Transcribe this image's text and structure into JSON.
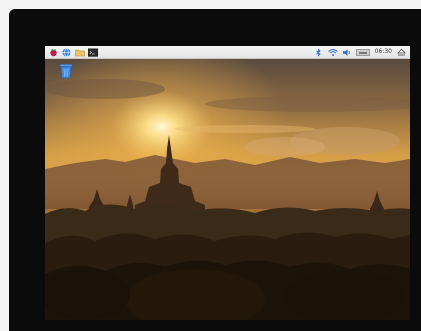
{
  "taskbar": {
    "launchers": [
      {
        "icon": "raspberry-menu-icon"
      },
      {
        "icon": "web-browser-icon"
      },
      {
        "icon": "file-manager-icon"
      },
      {
        "icon": "terminal-icon"
      }
    ],
    "tray": {
      "bluetooth_icon": "bluetooth-icon",
      "wifi_icon": "wifi-icon",
      "volume_icon": "volume-icon",
      "cpu_icon": "cpu-monitor-icon",
      "clock": "06:30",
      "eject_icon": "eject-icon"
    }
  },
  "desktop": {
    "icons": [
      {
        "icon": "wastebasket-icon"
      }
    ]
  },
  "colors": {
    "taskbar_bg": "#ececec",
    "accent": "#3b7dd8",
    "bezel": "#0b0b0b"
  }
}
